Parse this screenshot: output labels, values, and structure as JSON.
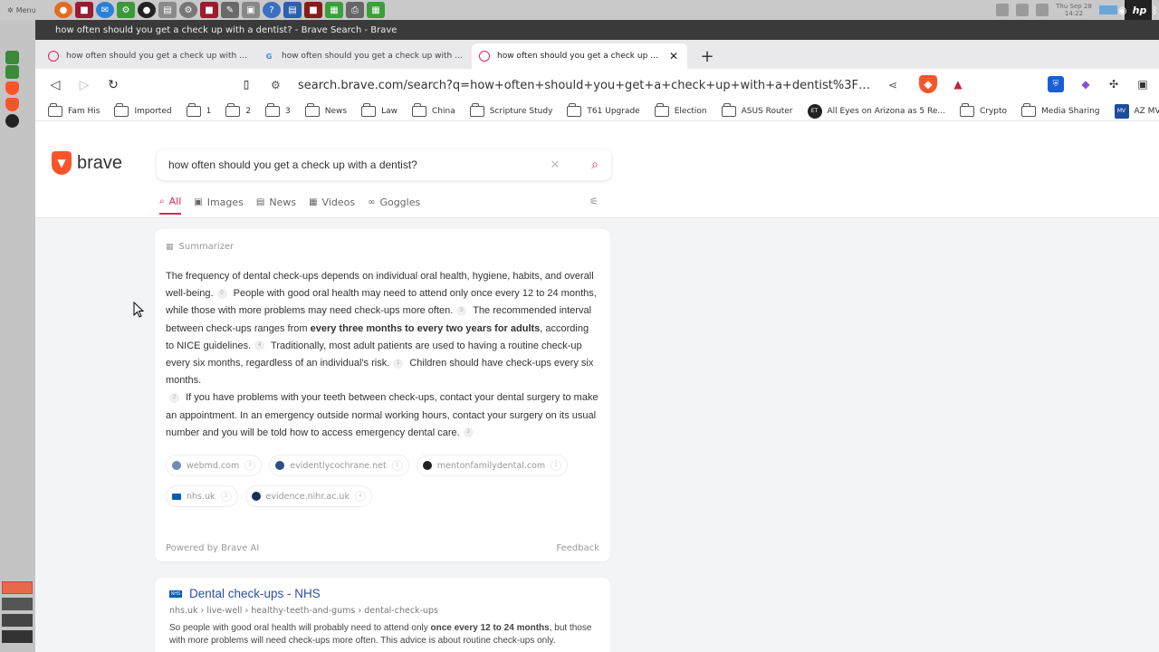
{
  "os": {
    "menu_label": "Menu",
    "clock_line1": "Thu Sep 28",
    "clock_line2": "14:22",
    "hp_label": "hp"
  },
  "window": {
    "title": "how often should you get a check up with a dentist? - Brave Search - Brave"
  },
  "tabs": [
    {
      "title": "how often should you get a check up with a generic..."
    },
    {
      "title": "how often should you get a check up with a generic..."
    },
    {
      "title": "how often should you get a check up with a dentist?"
    }
  ],
  "toolbar": {
    "url": "search.brave.com/search?q=how+often+should+you+get+a+check+up+with+a+dentist%3F&source..."
  },
  "bookmarks": [
    {
      "label": "Fam His"
    },
    {
      "label": "Imported"
    },
    {
      "label": "1"
    },
    {
      "label": "2"
    },
    {
      "label": "3"
    },
    {
      "label": "News"
    },
    {
      "label": "Law"
    },
    {
      "label": "China"
    },
    {
      "label": "Scripture Study"
    },
    {
      "label": "T61 Upgrade"
    },
    {
      "label": "Election"
    },
    {
      "label": "ASUS Router"
    },
    {
      "label": "All Eyes on Arizona as 5 Re..."
    },
    {
      "label": "Crypto"
    },
    {
      "label": "Media Sharing"
    },
    {
      "label": "AZ MVD"
    }
  ],
  "search": {
    "logo_text": "brave",
    "query": "how often should you get a check up with a dentist?",
    "filters": [
      "All",
      "Images",
      "News",
      "Videos",
      "Goggles"
    ]
  },
  "summarizer": {
    "label": "Summarizer",
    "p1": "The frequency of dental check-ups depends on individual oral health, hygiene, habits, and overall well-being.",
    "c1": "0",
    "p2": "People with good oral health may need to attend only once every 12 to 24 months, while those with more problems may need check-ups more often.",
    "c2": "3",
    "p3a": "The recommended interval between check-ups ranges from",
    "p3b": "every three months to every two years for adults",
    "p3c": ", according to NICE guidelines.",
    "c3": "4",
    "p4": "Traditionally, most adult patients are used to having a routine check-up every six months, regardless of an individual's risk.",
    "c4": "1",
    "p5": "Children should have check-ups every six months.",
    "c5": "2",
    "p6": "If you have problems with your teeth between check-ups, contact your dental surgery to make an appointment. In an emergency outside normal working hours, contact your surgery on its usual number and you will be told how to access emergency dental care.",
    "c6": "3",
    "sources": [
      {
        "name": "webmd.com",
        "num": "0"
      },
      {
        "name": "evidentlycochrane.net",
        "num": "1"
      },
      {
        "name": "mentonfamilydental.com",
        "num": "2"
      },
      {
        "name": "nhs.uk",
        "num": "3"
      },
      {
        "name": "evidence.nihr.ac.uk",
        "num": "4"
      }
    ],
    "powered_by": "Powered by Brave AI",
    "feedback": "Feedback"
  },
  "result": {
    "title": "Dental check-ups - NHS",
    "url": "nhs.uk › live-well › healthy-teeth-and-gums › dental-check-ups",
    "snippet_a": "So people with good oral health will probably need to attend only ",
    "snippet_b": "once every 12 to 24 months",
    "snippet_c": ", but those with more problems will need check-ups more often. This advice is about routine check-ups only."
  }
}
